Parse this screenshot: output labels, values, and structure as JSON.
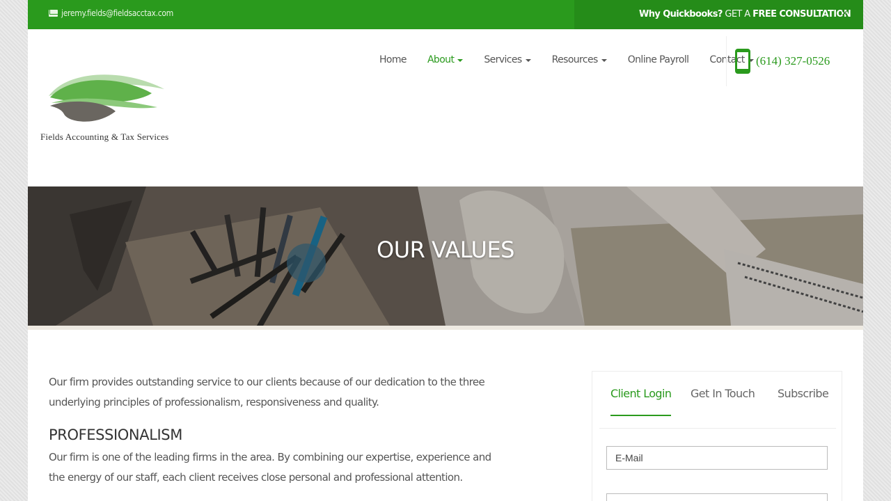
{
  "topbar": {
    "email": "jeremy.fields@fieldsacctax.com",
    "promo_bold": "Why Quickbooks?",
    "promo_mid": " GET A ",
    "promo_cta": "FREE CONSULTATION",
    "close": "×"
  },
  "logo": {
    "text": "Fields Accounting & Tax Services"
  },
  "nav": {
    "home": "Home",
    "about": "About",
    "services": "Services",
    "resources": "Resources",
    "payroll": "Online Payroll",
    "contact": "Contact"
  },
  "phone": {
    "number": "(614) 327-0526"
  },
  "hero": {
    "title": "OUR VALUES"
  },
  "content": {
    "intro": "Our firm provides outstanding service to our clients because of our dedication to the three underlying principles of professionalism, responsiveness and quality.",
    "heading": "PROFESSIONALISM",
    "body": "Our firm is one of the leading firms in the area. By combining our expertise, experience and the energy of our staff, each client receives close personal and professional attention."
  },
  "sidebar": {
    "tabs": [
      "Client Login",
      "Get In Touch",
      "Subscribe"
    ],
    "email_placeholder": "E-Mail"
  },
  "colors": {
    "brand_green": "#2a9a1d"
  }
}
